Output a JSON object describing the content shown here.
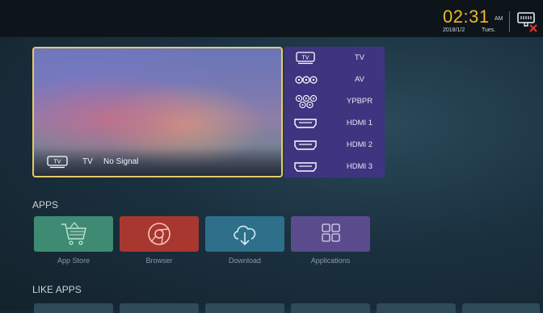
{
  "status_bar": {
    "time": "02:31",
    "ampm": "AM",
    "date": "2018/1/2",
    "weekday": "Tues.",
    "network_icon": "ethernet-disconnected-icon"
  },
  "preview": {
    "source_badge": "TV",
    "label": "TV",
    "status": "No Signal",
    "border_color": "#e6c968"
  },
  "sources": [
    {
      "icon": "tv-icon",
      "icon_text": "TV",
      "label": "TV"
    },
    {
      "icon": "av-rca-icon",
      "label": "AV"
    },
    {
      "icon": "ypbpr-component-icon",
      "label": "YPBPR"
    },
    {
      "icon": "hdmi-port-icon",
      "label": "HDMI 1"
    },
    {
      "icon": "hdmi-port-icon",
      "label": "HDMI 2"
    },
    {
      "icon": "hdmi-port-icon",
      "label": "HDMI 3"
    }
  ],
  "apps_section": {
    "title": "APPS",
    "items": [
      {
        "label": "App Store",
        "icon": "shopping-cart-icon",
        "color": "#3f8a72"
      },
      {
        "label": "Browser",
        "icon": "chrome-icon",
        "color": "#a8372f"
      },
      {
        "label": "Download",
        "icon": "cloud-download-icon",
        "color": "#2e6f8a"
      },
      {
        "label": "Applications",
        "icon": "grid-apps-icon",
        "color": "#5a4c8c"
      }
    ]
  },
  "like_apps_section": {
    "title": "LIKE APPS"
  },
  "colors": {
    "accent_time": "#f2b623",
    "source_panel": "#3e3580",
    "network_error": "#e0332a"
  }
}
